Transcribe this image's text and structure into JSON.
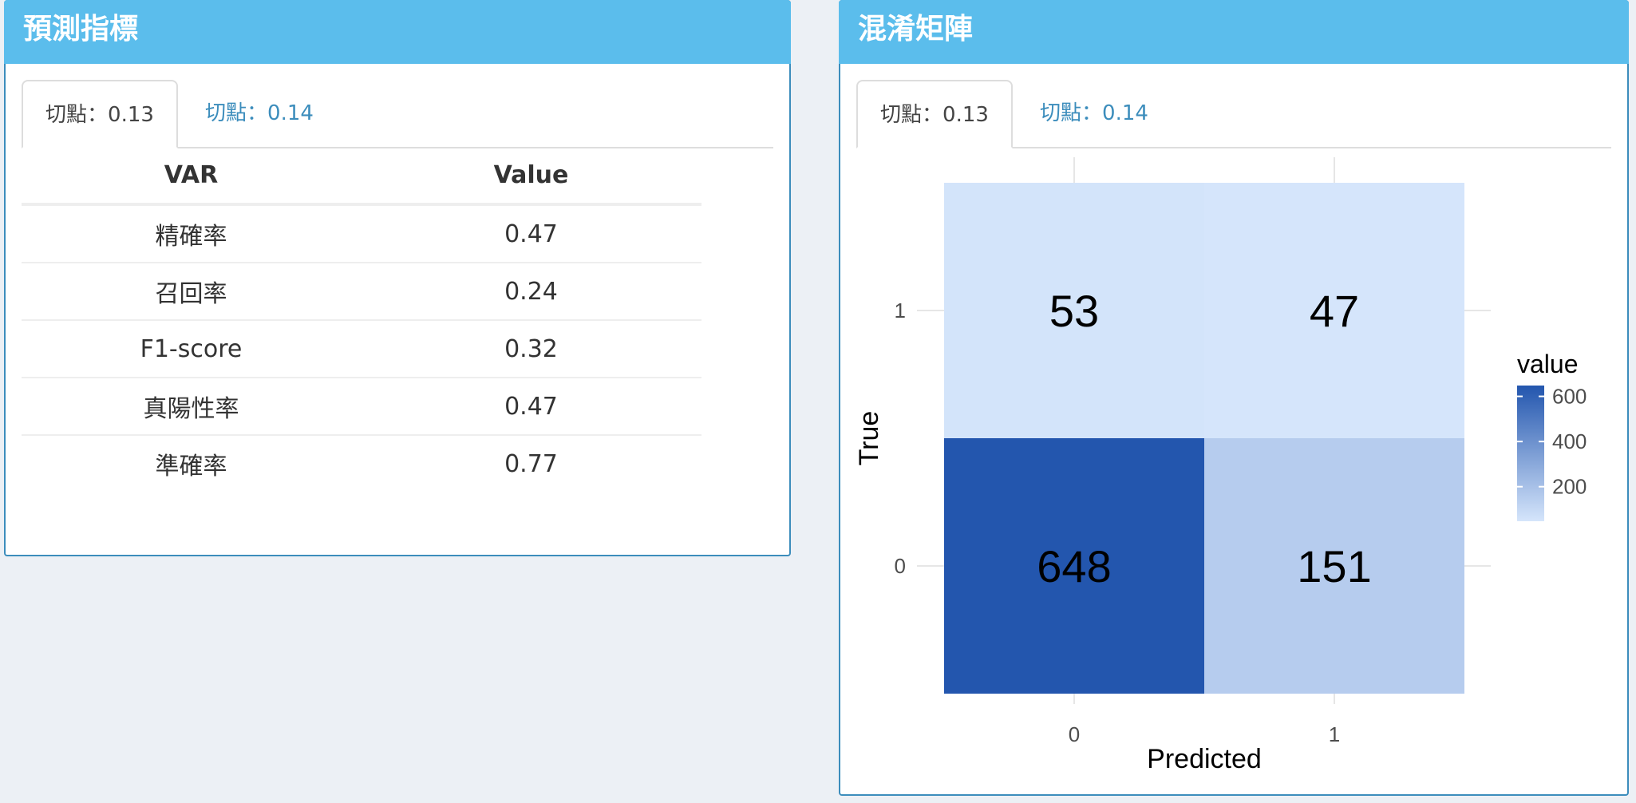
{
  "metrics_panel": {
    "title": "預測指標",
    "tabs": [
      {
        "label": "切點：0.13",
        "active": true
      },
      {
        "label": "切點：0.14",
        "active": false
      }
    ],
    "table": {
      "headers": [
        "VAR",
        "Value"
      ],
      "rows": [
        [
          "精確率",
          "0.47"
        ],
        [
          "召回率",
          "0.24"
        ],
        [
          "F1-score",
          "0.32"
        ],
        [
          "真陽性率",
          "0.47"
        ],
        [
          "準確率",
          "0.77"
        ]
      ]
    }
  },
  "matrix_panel": {
    "title": "混淆矩陣",
    "tabs": [
      {
        "label": "切點：0.13",
        "active": true
      },
      {
        "label": "切點：0.14",
        "active": false
      }
    ]
  },
  "colors": {
    "header_bg": "#5bbdec",
    "box_border": "#3c8dbc",
    "tab_link": "#3c8dbc",
    "scale_low": "#d5e5fb",
    "scale_high": "#2356ae",
    "page_bg": "#ecf0f5"
  },
  "chart_data": {
    "type": "heatmap",
    "x_categories": [
      "0",
      "1"
    ],
    "y_categories": [
      "0",
      "1"
    ],
    "cells": [
      {
        "x": "0",
        "y": "1",
        "value": 53
      },
      {
        "x": "1",
        "y": "1",
        "value": 47
      },
      {
        "x": "0",
        "y": "0",
        "value": 648
      },
      {
        "x": "1",
        "y": "0",
        "value": 151
      }
    ],
    "xlabel": "Predicted",
    "ylabel": "True",
    "legend": {
      "title": "value",
      "ticks": [
        600,
        400,
        200
      ],
      "range": [
        47,
        648
      ],
      "placement": "right"
    },
    "grid": true
  }
}
